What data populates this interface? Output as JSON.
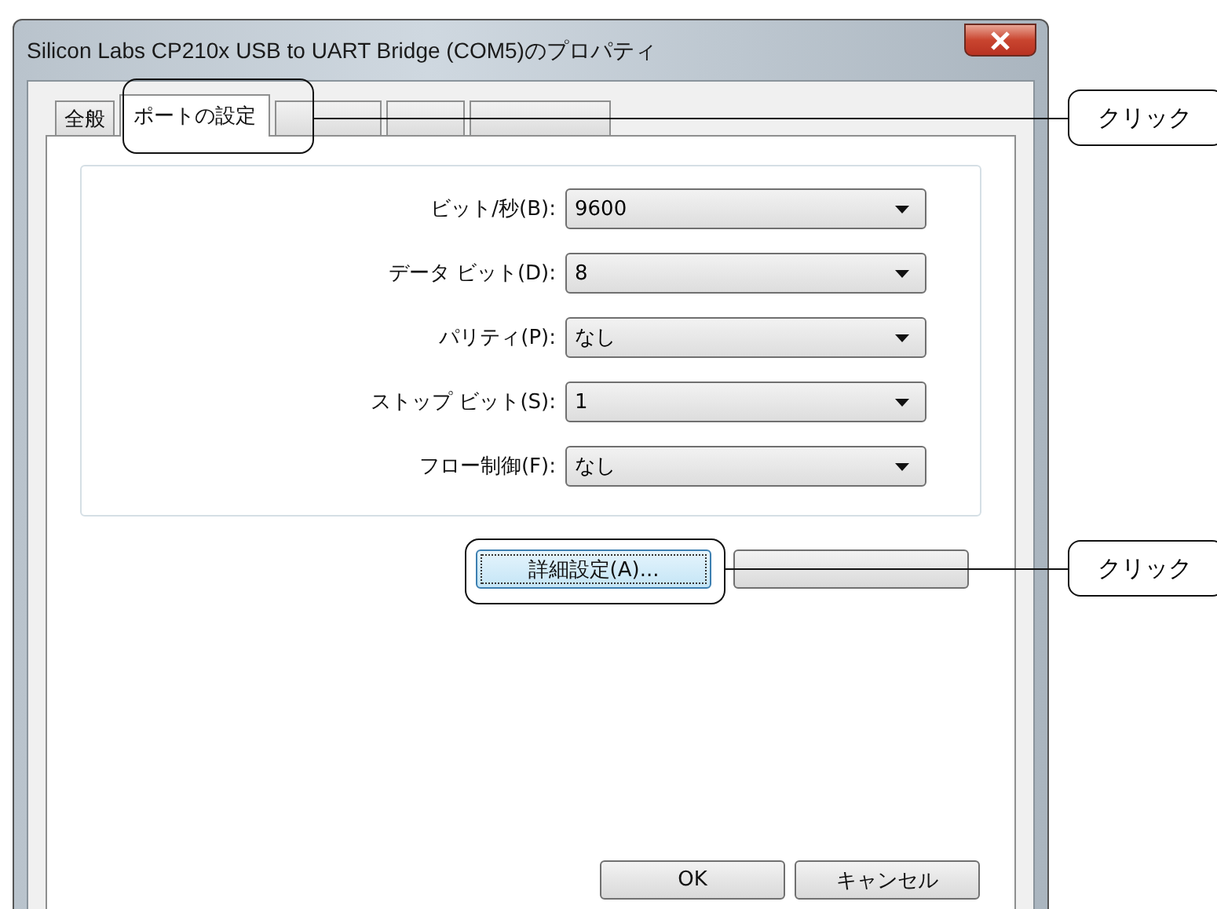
{
  "window": {
    "title": "Silicon Labs CP210x USB to UART Bridge (COM5)のプロパティ"
  },
  "tabs": [
    {
      "label": "全般",
      "selected": false
    },
    {
      "label": "ポートの設定",
      "selected": true
    },
    {
      "selected": false
    },
    {
      "selected": false
    },
    {
      "selected": false
    }
  ],
  "settings": [
    {
      "label": "ビット/秒(B):",
      "value": "9600"
    },
    {
      "label": "データ ビット(D):",
      "value": "8"
    },
    {
      "label": "パリティ(P):",
      "value": "なし"
    },
    {
      "label": "ストップ ビット(S):",
      "value": "1"
    },
    {
      "label": "フロー制御(F):",
      "value": "なし"
    }
  ],
  "panel_buttons": [
    {
      "label": "詳細設定(A)...",
      "focused": true
    },
    {
      "focused": false
    }
  ],
  "dialog_buttons": [
    "OK",
    "キャンセル"
  ],
  "callouts": [
    {
      "text": "クリック"
    },
    {
      "text": "クリック"
    }
  ]
}
